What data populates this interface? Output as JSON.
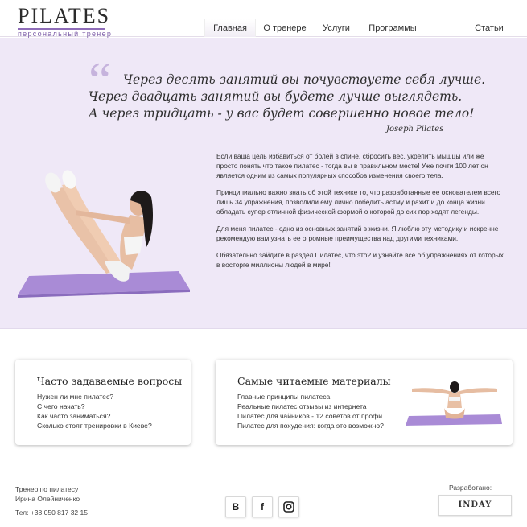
{
  "header": {
    "logo_text": "PILATES",
    "logo_sub": "персональный тренер",
    "nav": [
      "Главная",
      "О тренере",
      "Услуги",
      "Программы",
      "Статьи"
    ]
  },
  "hero": {
    "quote_lines": [
      "Через десять занятий вы почувствуете себя лучше.",
      "Через двадцать занятий вы будете лучше выглядеть.",
      "А через тридцать - у вас будет совершенно новое тело!"
    ],
    "quote_author": "Joseph Pilates",
    "paragraphs": [
      "Если ваша цель избавиться от болей в спине, сбросить вес, укрепить мышцы или же просто понять что такое пилатес - тогда вы в правильном месте! Уже почти 100 лет он является одним из самых популярных способов изменения своего тела.",
      "Принципиально важно знать об этой технике то, что разработанные ее основателем всего лишь 34 упражнения, позволили ему лично победить астму и рахит и до конца жизни обладать супер отличной физической формой о которой до сих пор ходят легенды.",
      "Для меня пилатес - одно из основных занятий в жизни. Я люблю эту методику и искренне рекомендую вам узнать ее огромные преимущества над другими техниками.",
      "Обязательно зайдите в раздел Пилатес, что это? и узнайте все об упражнениях от которых в восторге миллионы людей в мире!"
    ]
  },
  "faq": {
    "title": "Часто задаваемые вопросы",
    "items": [
      "Нужен ли мне пилатес?",
      "С чего начать?",
      "Как часто заниматься?",
      "Сколько стоят тренировки в Киеве?"
    ]
  },
  "popular": {
    "title": "Самые читаемые материалы",
    "items": [
      "Главные принципы пилатеса",
      "Реальные пилатес отзывы из интернета",
      "Пилатес для чайников - 12 советов от профи",
      "Пилатес для похудения: когда это возможно?"
    ]
  },
  "footer": {
    "trainer_line1": "Тренер по пилатесу",
    "trainer_line2": "Ирина Олейниченко",
    "phone": "Тел: +38 050 817 32 15",
    "social": [
      "В",
      "f",
      "instagram-icon"
    ],
    "dev_label": "Разработано:",
    "dev_name": "INDAY"
  },
  "colors": {
    "accent": "#8e6cb8",
    "hero_bg": "#efe8f7",
    "mat": "#a98bd6"
  }
}
